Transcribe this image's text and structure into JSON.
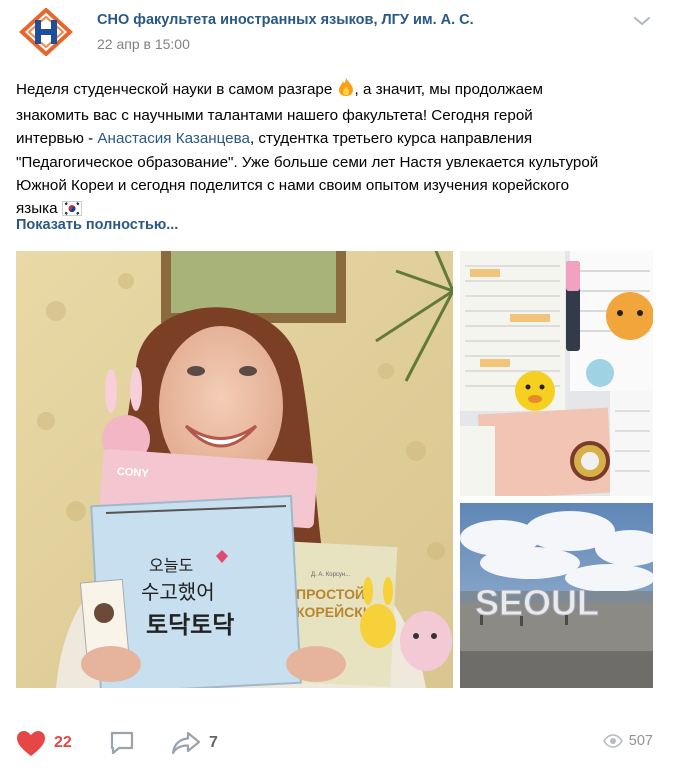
{
  "header": {
    "group_name": "СНО факультета иностранных языков, ЛГУ им. А. С.",
    "date": "22 апр в 15:00"
  },
  "text": {
    "l1a": "Неделя студенческой науки в самом разгаре ",
    "l1b": ", а значит, мы продолжаем",
    "l2": "знакомить вас с научными талантами нашего факультета! Сегодня герой",
    "l3a": "интервью - ",
    "mention": "Анастасия Казанцева",
    "l3b": ", студентка третьего курса направления",
    "l4": "\"Педагогическое образование\". Уже больше семи лет Настя увлекается культурой",
    "l5": "Южной Кореи и сегодня поделится с нами своим опытом изучения корейского",
    "l6": "языка ",
    "emoji_fire": "fire-emoji",
    "emoji_flag": "south-korea-flag-emoji"
  },
  "show_more": "Показать полностью...",
  "photos": {
    "main": {
      "book_label": "CONY",
      "cover_line1": "오늘도",
      "cover_line2": "수고했어",
      "cover_line3": "토닥토닥",
      "book2_author": "Д. А. Корсун...",
      "book2_title1": "ПРОСТОЙ",
      "book2_title2": "КОРЕЙСКИЙ"
    },
    "seoul": {
      "sign": "SEOUL"
    }
  },
  "footer": {
    "likes": "22",
    "shares": "7",
    "views": "507",
    "like_color": "#e64646"
  },
  "icons": [
    "heart-icon",
    "comment-icon",
    "share-icon",
    "eye-icon",
    "chevron-down-icon"
  ]
}
